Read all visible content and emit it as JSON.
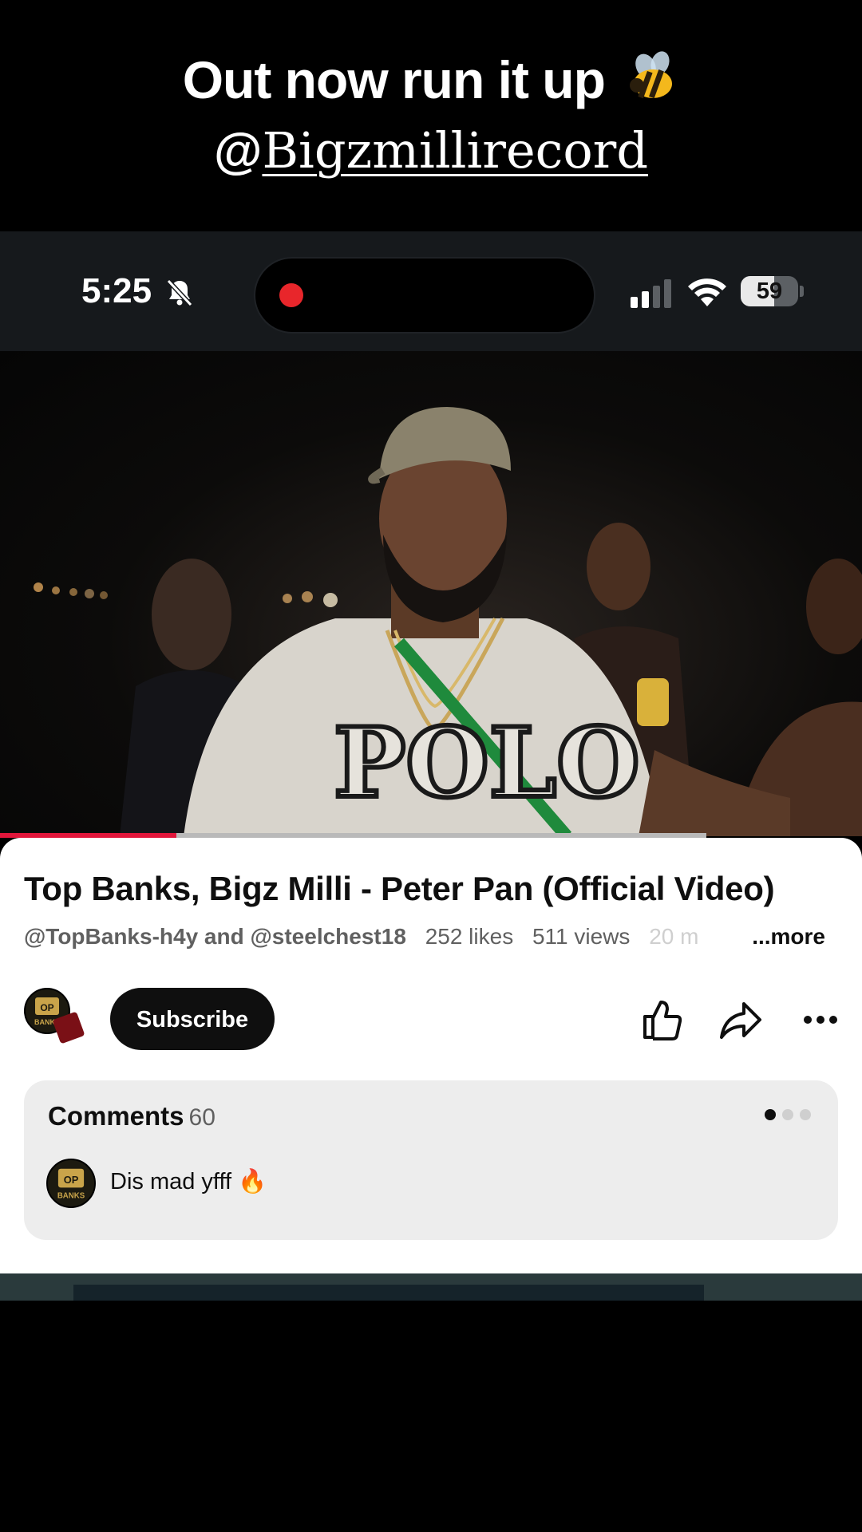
{
  "caption": {
    "line1": "Out now run it up",
    "line2_at": "@",
    "line2_handle": "Bigzmillirecord"
  },
  "status_bar": {
    "time": "5:25",
    "battery": "59",
    "battery_level": 0.59
  },
  "video": {
    "progress": 0.25
  },
  "info": {
    "title": "Top Banks, Bigz Milli - Peter Pan (Official Video)",
    "channels": "@TopBanks-h4y and @steelchest18",
    "likes": "252 likes",
    "views": "511 views",
    "age": "20 m",
    "more": "...more"
  },
  "actions": {
    "subscribe": "Subscribe"
  },
  "comments": {
    "label": "Comments",
    "count": "60",
    "first_comment": "Dis mad yfff 🔥"
  },
  "colors": {
    "progress": "#e2163b",
    "record_dot": "#e8262b",
    "sheet": "#ffffff",
    "comment_card": "#ededed"
  }
}
